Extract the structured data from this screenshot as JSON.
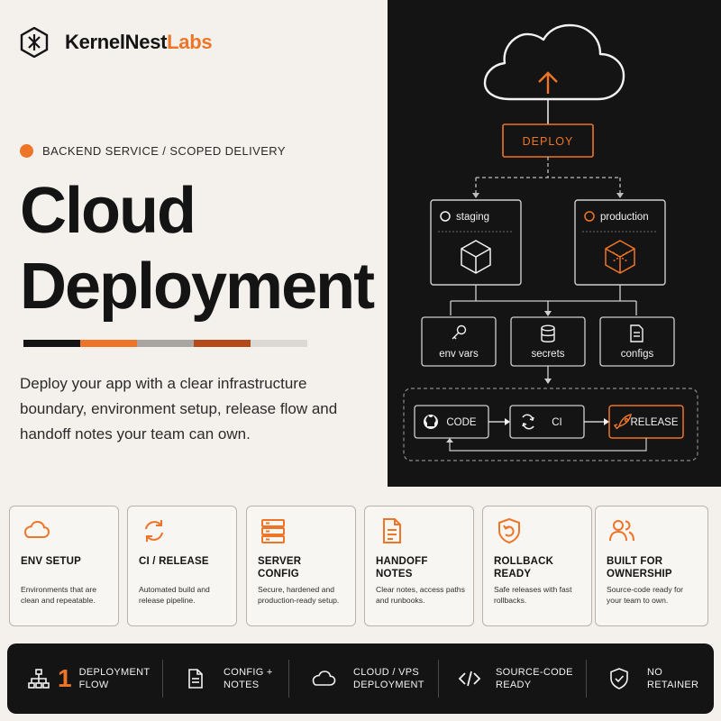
{
  "brand": {
    "name_part1": "KernelNest",
    "name_part2": "Labs"
  },
  "hero": {
    "kicker": "BACKEND SERVICE / SCOPED DELIVERY",
    "title_line1": "Cloud",
    "title_line2": "Deployment",
    "description": "Deploy your app with a clear infrastructure boundary, environment setup, release flow and handoff notes your team can own."
  },
  "colors": {
    "accent": "#ee7528",
    "dark": "#141414",
    "background": "#f4f1ec",
    "swatches": [
      "#141414",
      "#ee7528",
      "#a9a6a1",
      "#b5491a",
      "#dcd8d2"
    ]
  },
  "diagram": {
    "deploy": "DEPLOY",
    "environments": [
      "staging",
      "production"
    ],
    "config_nodes": [
      "env vars",
      "secrets",
      "configs"
    ],
    "pipeline": [
      "CODE",
      "CI",
      "RELEASE"
    ]
  },
  "features": [
    {
      "icon": "cloud-icon",
      "title1": "ENV SETUP",
      "title2": "",
      "desc": "Environments that are clean and repeatable."
    },
    {
      "icon": "refresh-icon",
      "title1": "CI / RELEASE",
      "title2": "",
      "desc": "Automated build and release pipeline."
    },
    {
      "icon": "server-icon",
      "title1": "SERVER",
      "title2": "CONFIG",
      "desc": "Secure, hardened and production-ready setup."
    },
    {
      "icon": "document-icon",
      "title1": "HANDOFF",
      "title2": "NOTES",
      "desc": "Clear notes, access paths and runbooks."
    },
    {
      "icon": "shield-undo-icon",
      "title1": "ROLLBACK",
      "title2": "READY",
      "desc": "Safe releases with fast rollbacks."
    },
    {
      "icon": "users-icon",
      "title1": "BUILT FOR",
      "title2": "OWNERSHIP",
      "desc": "Source-code ready for your team to own."
    }
  ],
  "bar": [
    {
      "icon": "sitemap-icon",
      "number": "1",
      "line1": "DEPLOYMENT",
      "line2": "FLOW"
    },
    {
      "icon": "document-icon",
      "line1": "CONFIG +",
      "line2": "NOTES"
    },
    {
      "icon": "cloud-icon",
      "line1": "CLOUD / VPS",
      "line2": "DEPLOYMENT"
    },
    {
      "icon": "code-icon",
      "line1": "SOURCE-CODE",
      "line2": "READY"
    },
    {
      "icon": "shield-check-icon",
      "line1": "NO",
      "line2": "RETAINER"
    }
  ]
}
